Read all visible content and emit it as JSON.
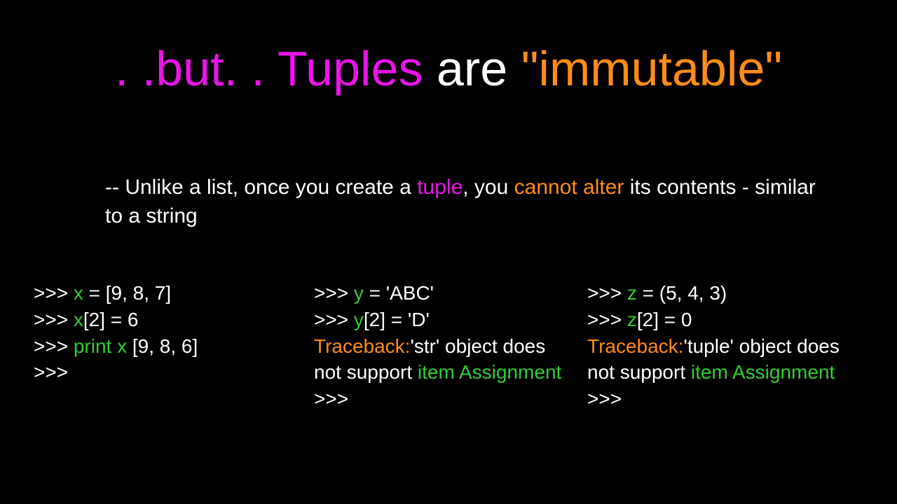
{
  "title": {
    "part1": ". .but. . Tuples",
    "part2": " are ",
    "part3": "\"immutable\""
  },
  "bullet": {
    "prefix": "-- Unlike a list, once you create a ",
    "tuple": "tuple",
    "mid1": ", you ",
    "cannot_alter": "cannot alter",
    "suffix": " its contents - similar to a string"
  },
  "col1": {
    "l1a": ">>> ",
    "l1b": "x",
    "l1c": " = [9, 8, 7]",
    "l2a": ">>> ",
    "l2b": "x",
    "l2c": "[2] = 6",
    "l3a": ">>> ",
    "l3b": "print x ",
    "l3c": " [9, 8, 6]",
    "l4": ">>>"
  },
  "col2": {
    "l1a": ">>> ",
    "l1b": "y",
    "l1c": " = 'ABC'",
    "l2a": ">>> ",
    "l2b": "y",
    "l2c": "[2] = 'D'",
    "l3a": "Traceback:",
    "l3b": "'str' object does not support ",
    "l3c": "item Assignment",
    "l4": ">>>"
  },
  "col3": {
    "l1a": ">>> ",
    "l1b": "z",
    "l1c": " = (5, 4, 3)",
    "l2a": ">>> ",
    "l2b": "z",
    "l2c": "[2] = 0",
    "l3a": "Traceback:",
    "l3b": "'tuple' object does not support ",
    "l3c": "item Assignment",
    "l4": ">>>"
  }
}
